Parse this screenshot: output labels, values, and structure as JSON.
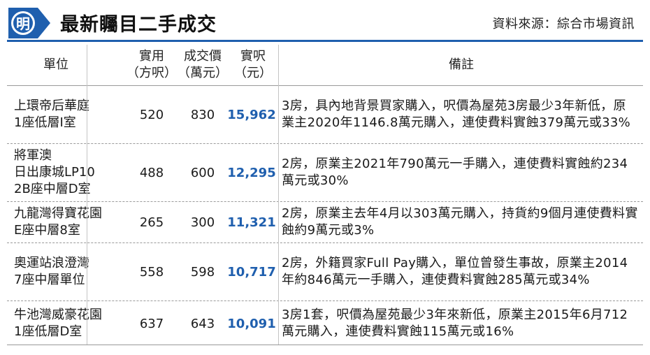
{
  "header": {
    "logo_char": "明",
    "title": "最新矚目二手成交",
    "source": "資料來源：綜合市場資訊",
    "accent_color": "#1f5fae"
  },
  "table": {
    "columns": {
      "unit": [
        "單位"
      ],
      "area": [
        "實用",
        "（方呎）"
      ],
      "price": [
        "成交價",
        "（萬元）"
      ],
      "psf": [
        "實呎",
        "（元）"
      ],
      "note": [
        "備註"
      ]
    },
    "rows": [
      {
        "unit": [
          "上環帝后華庭",
          "1座低層I室"
        ],
        "area": "520",
        "price": "830",
        "psf": "15,962",
        "note": "3房，具內地背景買家購入，呎價為屋苑3房最少3年新低，原業主2020年1146.8萬元購入，連使費料實蝕379萬元或33%"
      },
      {
        "unit": [
          "將軍澳",
          "日出康城LP10",
          "2B座中層D室"
        ],
        "area": "488",
        "price": "600",
        "psf": "12,295",
        "note": "2房，原業主2021年790萬元一手購入，連使費料實蝕約234萬元或30%"
      },
      {
        "unit": [
          "九龍灣得寶花園",
          "E座中層8室"
        ],
        "area": "265",
        "price": "300",
        "psf": "11,321",
        "note": "2房，原業主去年4月以303萬元購入，持貨約9個月連使費料實蝕約9萬元或3%"
      },
      {
        "unit": [
          "奧運站浪澄灣",
          "7座中層單位"
        ],
        "area": "558",
        "price": "598",
        "psf": "10,717",
        "note": "2房，外籍買家Full Pay購入，單位曾發生事故，原業主2014年約846萬元一手購入，連使費料實蝕285萬元或34%"
      },
      {
        "unit": [
          "牛池灣威豪花園",
          "1座低層D室"
        ],
        "area": "637",
        "price": "643",
        "psf": "10,091",
        "note": "3房1套，呎價為屋苑最少3年來新低，原業主2015年6月712萬元購入，連使費料實蝕115萬元或16%"
      }
    ]
  }
}
